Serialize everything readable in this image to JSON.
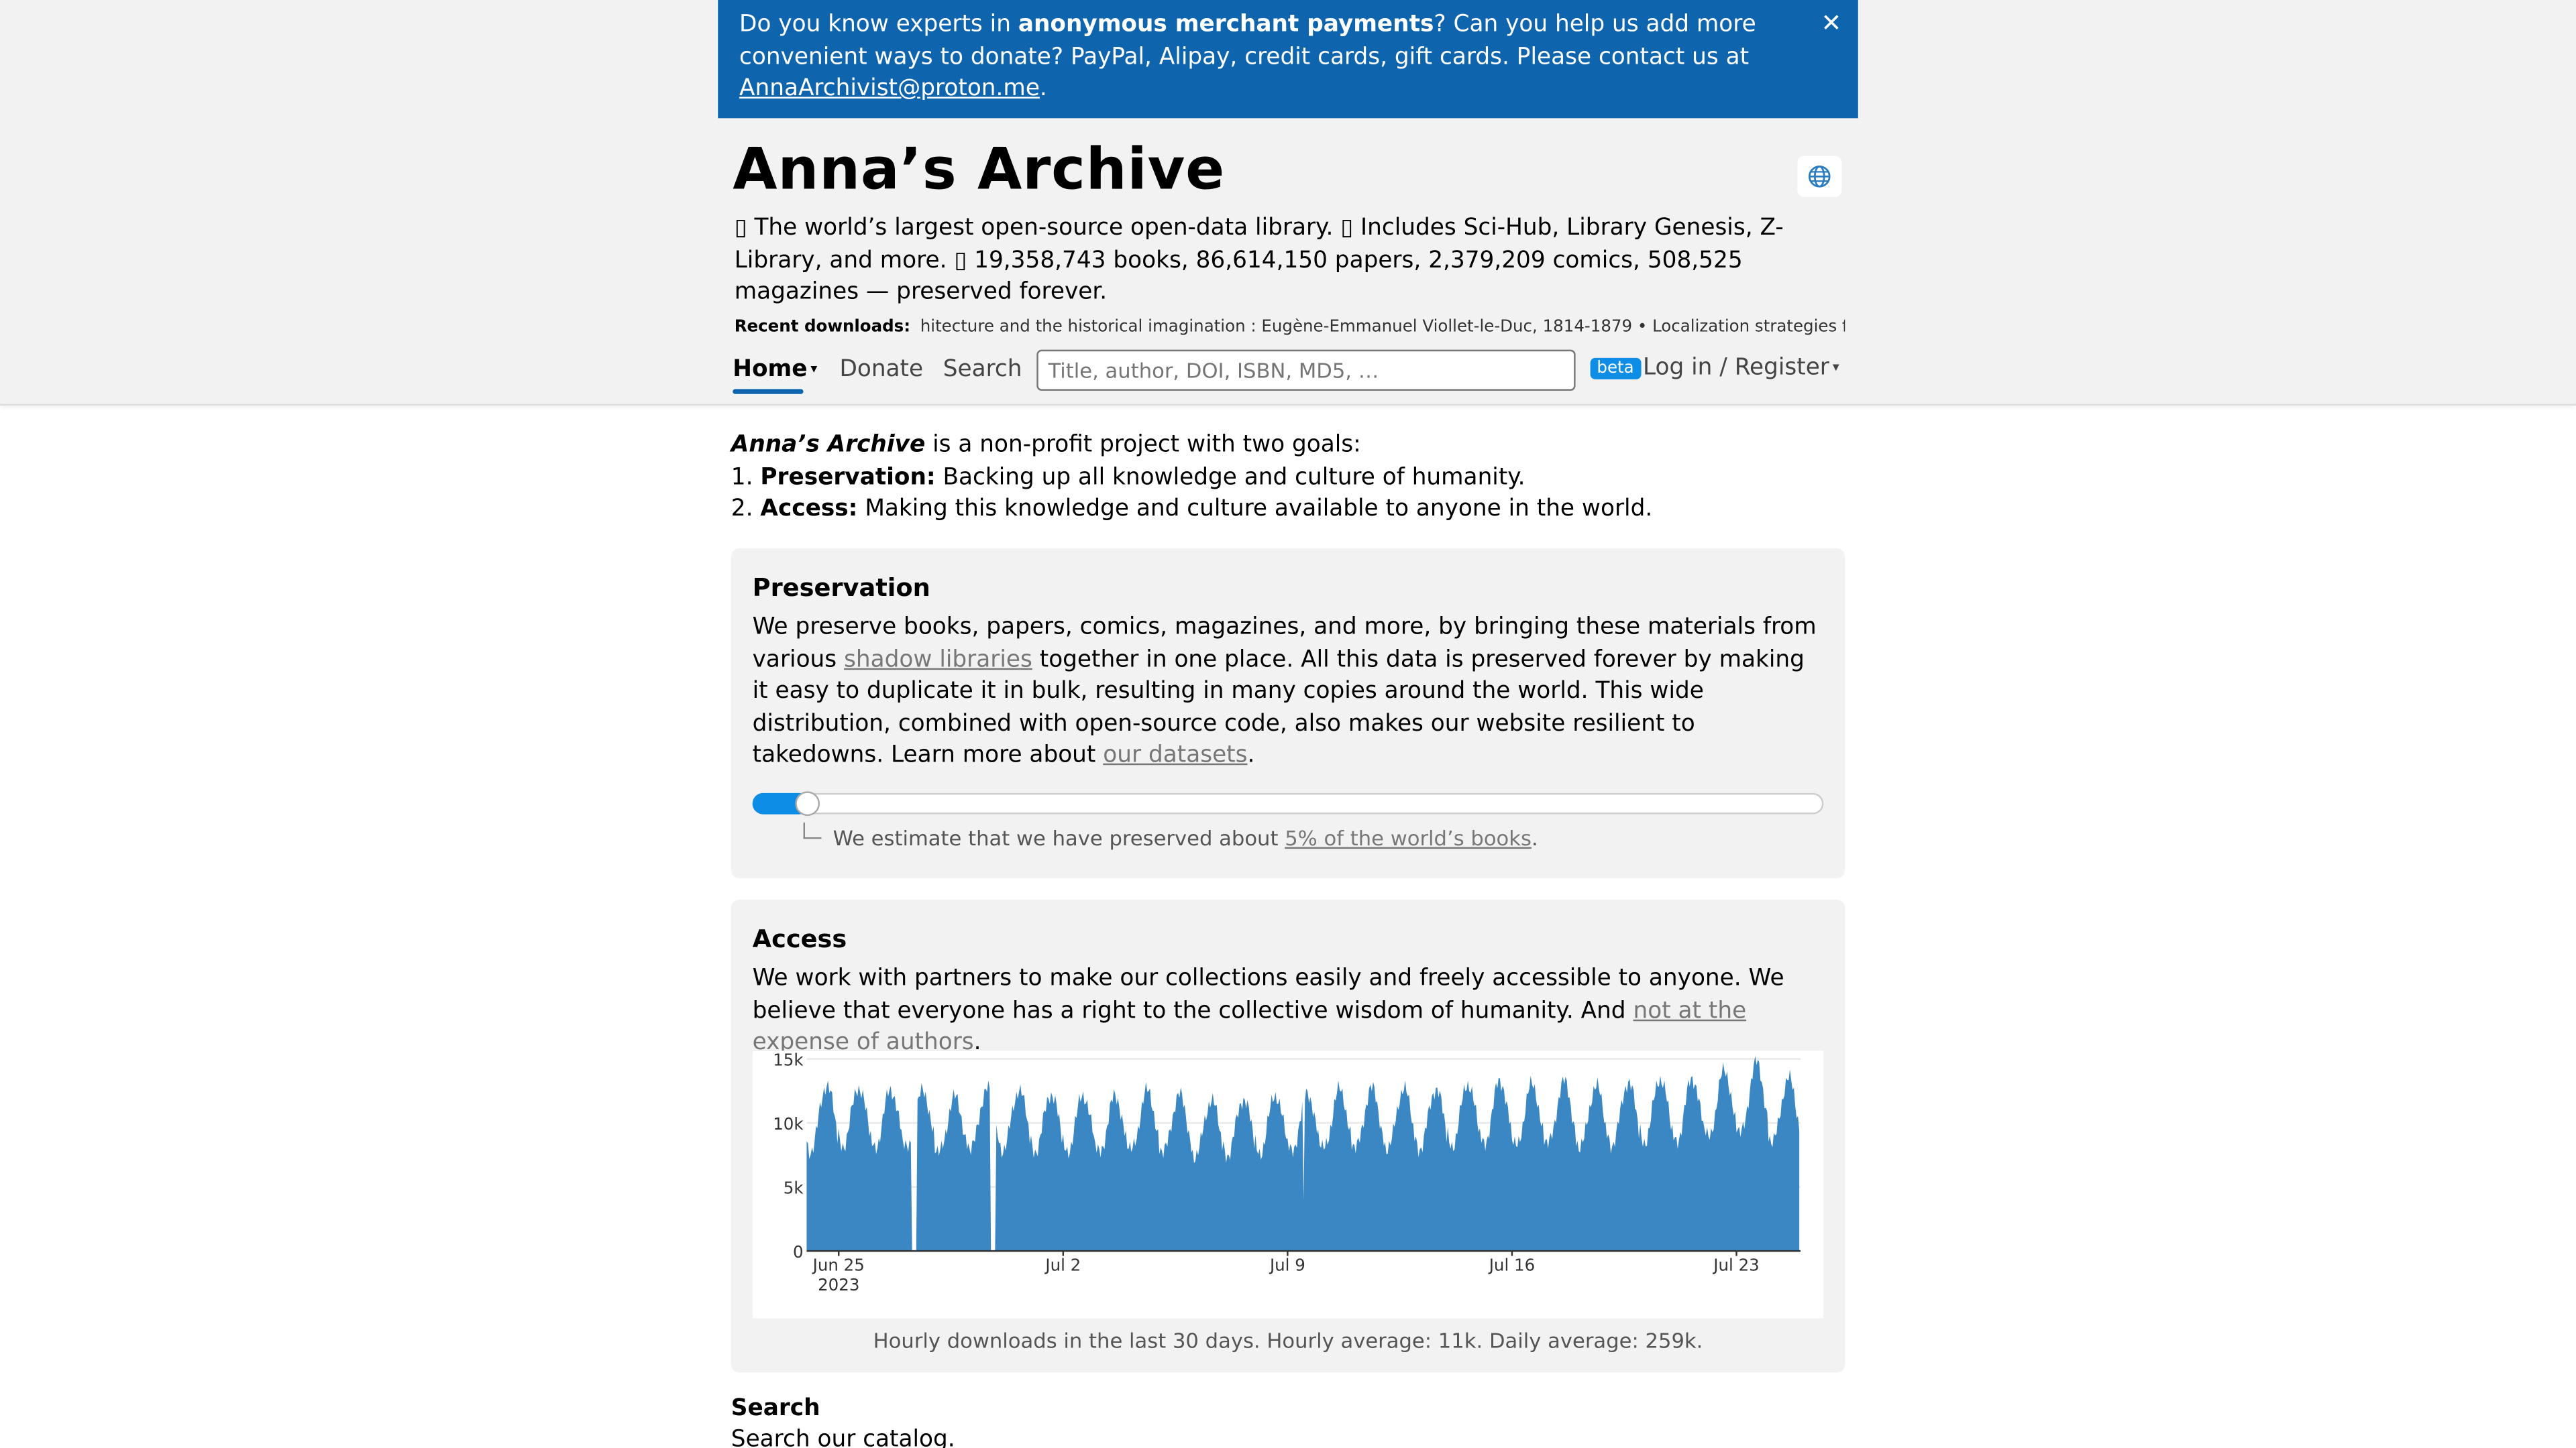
{
  "banner": {
    "text_before": "Do you know experts in ",
    "text_bold": "anonymous merchant payments",
    "text_after": "? Can you help us add more convenient ways to donate? PayPal, Alipay, credit cards, gift cards. Please contact us at ",
    "email": "AnnaArchivist@proton.me",
    "period": ".",
    "close_glyph": "✕"
  },
  "header": {
    "title": "Anna’s Archive",
    "lang_icon": "globe-icon",
    "tagline": "▯ The world’s largest open-source open-data library. ▯ Includes Sci-Hub, Library Genesis, Z-Library, and more. ▯ 19,358,743 books, 86,614,150 papers, 2,379,209 comics, 508,525 magazines — preserved forever.",
    "recent_label": "Recent downloads:",
    "recent_items": "hitecture and the historical imagination : Eugène-Emmanuel Viollet-le-Duc, 1814-1879 • Localization strategies for"
  },
  "nav": {
    "home": "Home",
    "donate": "Donate",
    "search": "Search",
    "search_placeholder": "Title, author, DOI, ISBN, MD5, …",
    "beta": "beta",
    "login": "Log in / Register",
    "caret": "▾"
  },
  "intro": {
    "name": "Anna’s Archive",
    "line1_rest": " is a non-profit project with two goals:",
    "goal1_num": "1. ",
    "goal1_label": "Preservation:",
    "goal1_text": " Backing up all knowledge and culture of humanity.",
    "goal2_num": "2. ",
    "goal2_label": "Access:",
    "goal2_text": " Making this knowledge and culture available to anyone in the world."
  },
  "preservation": {
    "heading": "Preservation",
    "p1": "We preserve books, papers, comics, magazines, and more, by bringing these materials from various ",
    "link1": "shadow libraries",
    "p2": " together in one place. All this data is preserved forever by making it easy to duplicate it in bulk, resulting in many copies around the world. This wide distribution, combined with open-source code, also makes our website resilient to takedowns. Learn more about ",
    "link2": "our datasets",
    "p3": ".",
    "progress_fraction": 0.05,
    "note_before": "We estimate that we have preserved about ",
    "note_link": "5% of the world’s books",
    "note_after": "."
  },
  "access": {
    "heading": "Access",
    "p1": "We work with partners to make our collections easily and freely accessible to anyone. We believe that everyone has a right to the collective wisdom of humanity. And ",
    "link": "not at the expense of authors",
    "p2": ".",
    "caption": "Hourly downloads in the last 30 days. Hourly average: 11k. Daily average: 259k."
  },
  "search_section": {
    "heading": "Search",
    "sub": "Search our catalog."
  },
  "chart_data": {
    "type": "area",
    "title": "",
    "xlabel": "",
    "ylabel": "",
    "x_range": [
      "2023-06-24",
      "2023-07-25"
    ],
    "ylim": [
      0,
      15000
    ],
    "y_ticks": [
      {
        "v": 0,
        "label": "0"
      },
      {
        "v": 5000,
        "label": "5k"
      },
      {
        "v": 10000,
        "label": "10k"
      },
      {
        "v": 15000,
        "label": "15k"
      }
    ],
    "x_ticks": [
      {
        "date": "2023-06-25",
        "label": "Jun 25",
        "sub": "2023"
      },
      {
        "date": "2023-07-02",
        "label": "Jul 2",
        "sub": ""
      },
      {
        "date": "2023-07-09",
        "label": "Jul 9",
        "sub": ""
      },
      {
        "date": "2023-07-16",
        "label": "Jul 16",
        "sub": ""
      },
      {
        "date": "2023-07-23",
        "label": "Jul 23",
        "sub": ""
      }
    ],
    "series_color": "#3a87c4",
    "daily_peaks": [
      13000,
      12800,
      12600,
      12500,
      12000,
      12700,
      12600,
      12300,
      12200,
      12100,
      12500,
      12200,
      11800,
      11900,
      12200,
      12300,
      12600,
      12700,
      12700,
      12700,
      13100,
      13300,
      13000,
      13200,
      12900,
      13200,
      13500,
      13500,
      14100,
      14700,
      13500
    ],
    "daily_troughs": [
      7800,
      8200,
      8000,
      7900,
      7600,
      8000,
      7900,
      7800,
      7700,
      7600,
      7800,
      7700,
      7400,
      7500,
      7600,
      7700,
      7900,
      8000,
      8000,
      8000,
      8200,
      8300,
      8100,
      8300,
      8100,
      8300,
      8500,
      8500,
      8800,
      9100,
      8500
    ],
    "outages": [
      {
        "start": "2023-06-27T07:00",
        "end": "2023-06-27T10:00"
      },
      {
        "start": "2023-06-29T18:00",
        "end": "2023-06-29T21:00"
      }
    ],
    "dips": [
      {
        "time": "2023-07-09T12:00",
        "value": 4000
      }
    ]
  }
}
